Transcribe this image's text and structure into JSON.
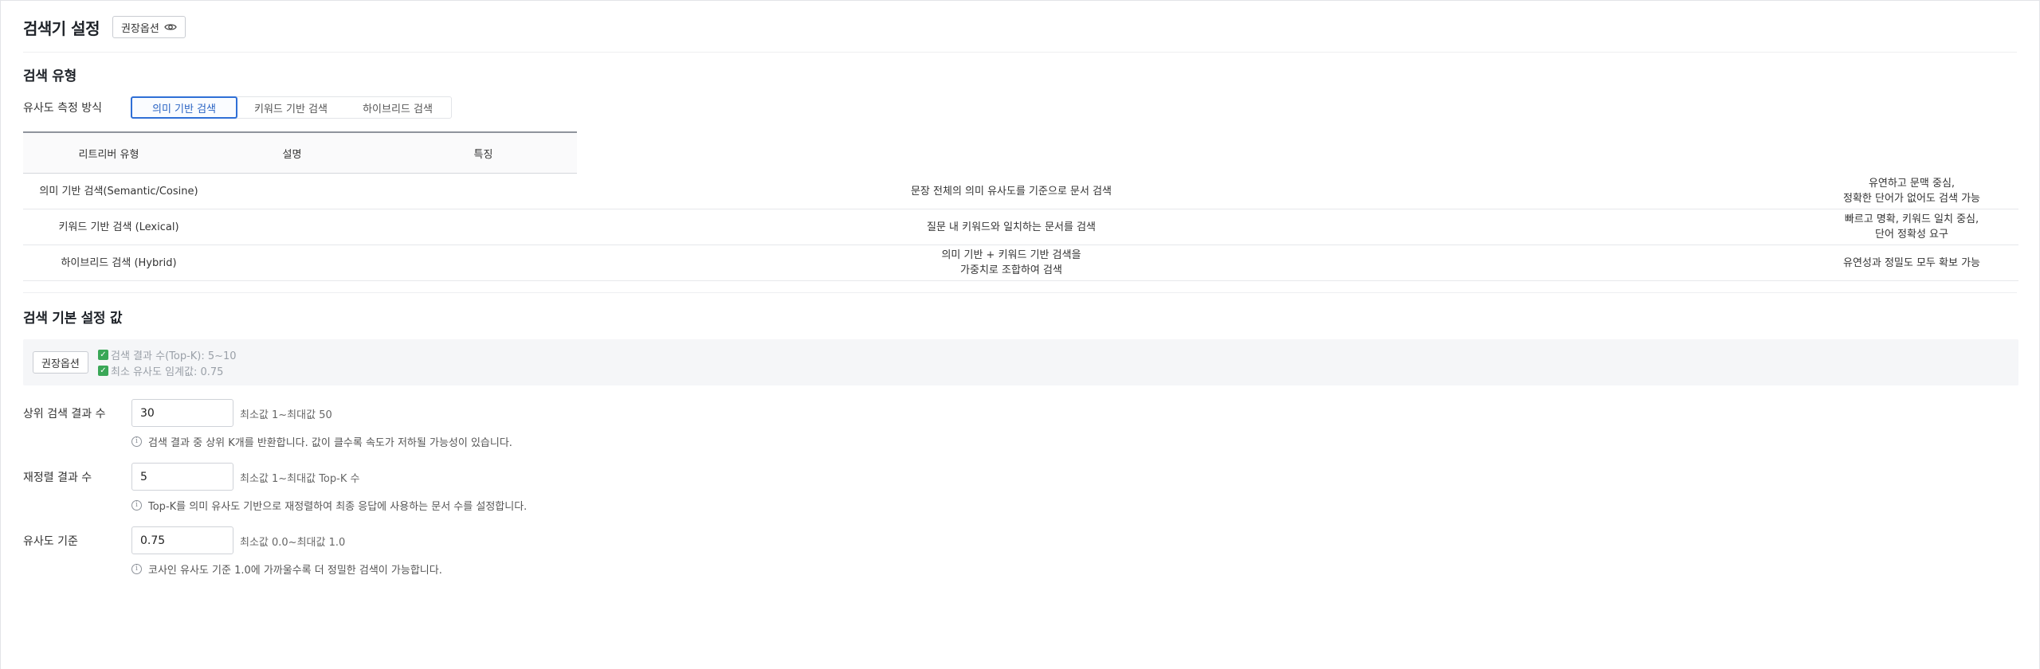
{
  "header": {
    "title": "검색기 설정",
    "recommend_button": "권장옵션",
    "recommend_icon": "eye-icon"
  },
  "search_type": {
    "title": "검색 유형",
    "similarity_label": "유사도 측정 방식",
    "options": [
      "의미 기반 검색",
      "키워드 기반 검색",
      "하이브리드 검색"
    ],
    "selected": "의미 기반 검색"
  },
  "table": {
    "headers": [
      "리트리버 유형",
      "설명",
      "특징"
    ],
    "rows": [
      {
        "type": "의미 기반 검색(Semantic/Cosine)",
        "desc": [
          "문장 전체의 의미 유사도를 기준으로 문서 검색"
        ],
        "feature": [
          "유연하고 문맥 중심,",
          "정확한 단어가 없어도 검색 가능"
        ]
      },
      {
        "type": "키워드 기반 검색 (Lexical)",
        "desc": [
          "질문 내 키워드와 일치하는 문서를 검색"
        ],
        "feature": [
          "빠르고 명확, 키워드 일치 중심,",
          "단어 정확성 요구"
        ]
      },
      {
        "type": "하이브리드 검색 (Hybrid)",
        "desc": [
          "의미 기반 + 키워드 기반 검색을",
          "가중치로 조합하여 검색"
        ],
        "feature": [
          "유연성과 정밀도 모두 확보 가능"
        ]
      }
    ]
  },
  "defaults": {
    "title": "검색 기본 설정 값",
    "recommend_button": "권장옵션",
    "recommend_lines": [
      "검색 결과 수(Top-K): 5~10",
      "최소 유사도 임계값: 0.75"
    ],
    "fields": [
      {
        "label": "상위 검색 결과 수",
        "value": "30",
        "range": "최소값 1~최대값 50",
        "help": "검색 결과 중 상위 K개를 반환합니다. 값이 클수록 속도가 저하될 가능성이 있습니다."
      },
      {
        "label": "재정렬 결과 수",
        "value": "5",
        "range": "최소값 1~최대값 Top-K 수",
        "help": "Top-K를 의미 유사도 기반으로 재정렬하여 최종 응답에 사용하는 문서 수를 설정합니다."
      },
      {
        "label": "유사도 기준",
        "value": "0.75",
        "range": "최소값 0.0~최대값 1.0",
        "help": "코사인 유사도 기준 1.0에 가까울수록 더 정밀한 검색이 가능합니다."
      }
    ]
  }
}
